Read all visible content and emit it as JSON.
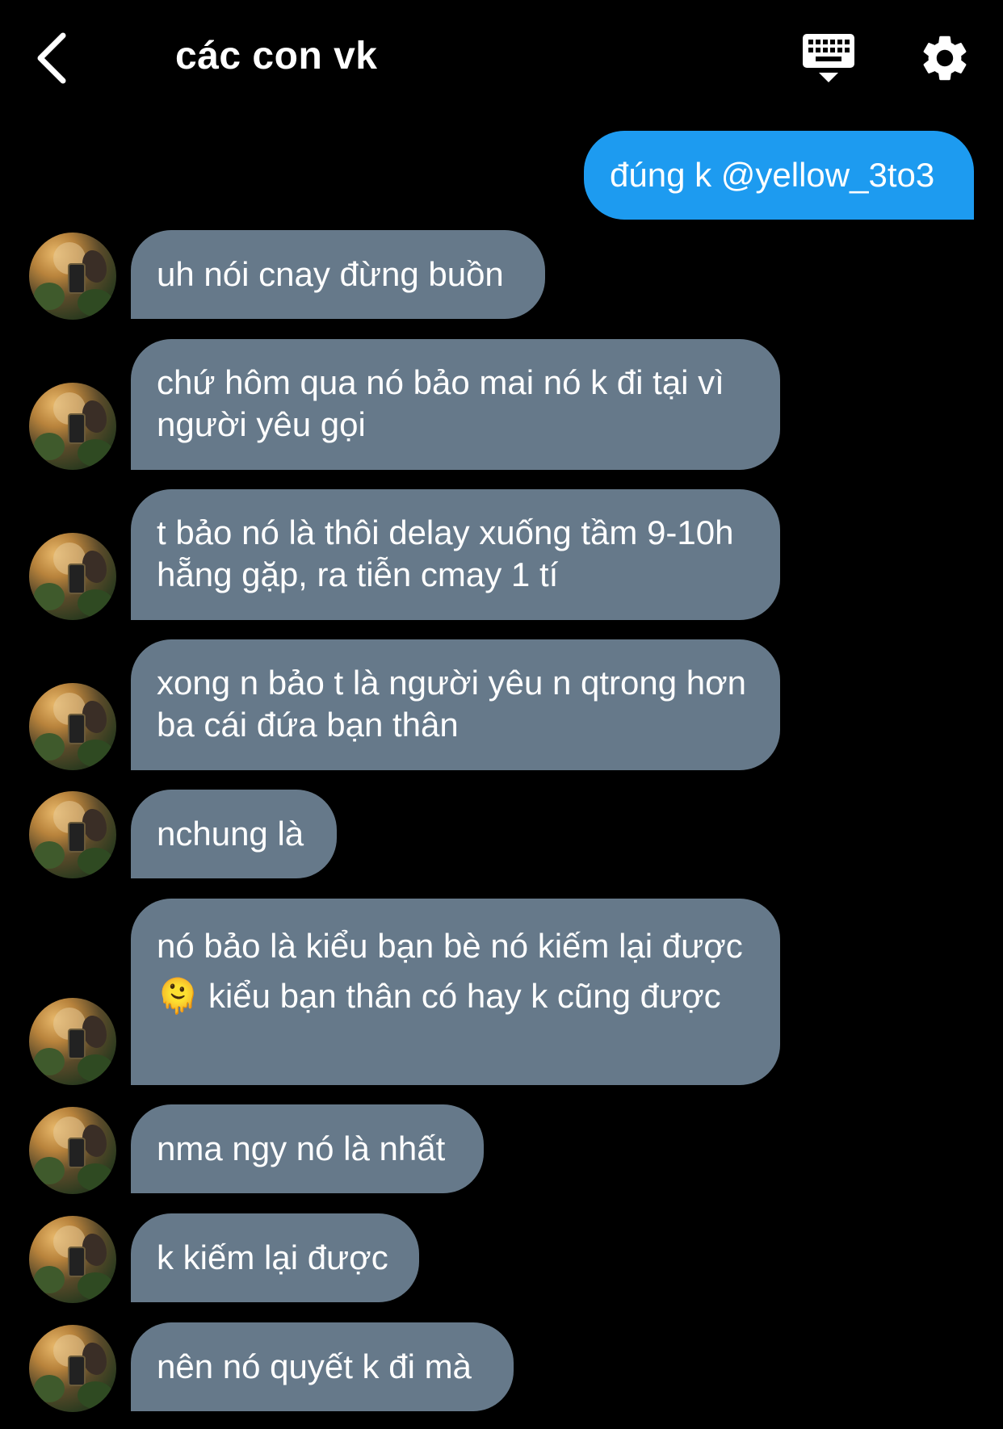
{
  "header": {
    "title": "các con vk"
  },
  "messages": [
    {
      "dir": "out",
      "text": "đúng k @yellow_3to3"
    },
    {
      "dir": "in",
      "text": "uh nói cnay đừng buồn"
    },
    {
      "dir": "in",
      "text": "chứ hôm qua nó bảo mai nó k đi tại vì người yêu gọi"
    },
    {
      "dir": "in",
      "text": "t bảo nó là thôi delay xuống tầm 9-10h hẵng gặp, ra tiễn cmay 1 tí"
    },
    {
      "dir": "in",
      "text": "xong n bảo t là người yêu n qtrong hơn ba cái đứa bạn thân"
    },
    {
      "dir": "in",
      "text": "nchung là"
    },
    {
      "dir": "in",
      "text": "nó bảo là kiểu bạn bè nó kiếm lại được🫠 kiểu bạn thân có hay k cũng được"
    },
    {
      "dir": "in",
      "text": "nma ngy nó là nhất"
    },
    {
      "dir": "in",
      "text": "k kiếm lại được"
    },
    {
      "dir": "in",
      "text": "nên nó quyết k đi mà"
    }
  ],
  "icons": {
    "back": "chevron-left-icon",
    "keyboard": "keyboard-icon",
    "settings": "gear-icon"
  },
  "colors": {
    "background": "#000000",
    "outgoing_bubble": "#1d9bf0",
    "incoming_bubble": "#66798a",
    "text": "#ffffff"
  }
}
